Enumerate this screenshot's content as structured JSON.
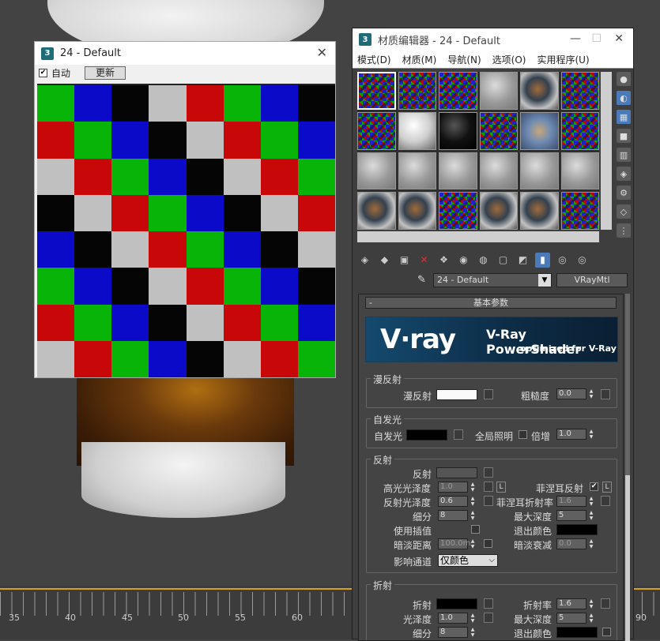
{
  "preview_window": {
    "title": "24 - Default",
    "auto_label": "自动",
    "auto_checked": true,
    "update_label": "更新"
  },
  "checker_grid": [
    [
      "green",
      "blue",
      "black",
      "gray",
      "red",
      "green",
      "blue",
      "black"
    ],
    [
      "red",
      "green",
      "blue",
      "black",
      "gray",
      "red",
      "green",
      "blue"
    ],
    [
      "gray",
      "red",
      "green",
      "blue",
      "black",
      "gray",
      "red",
      "green"
    ],
    [
      "black",
      "gray",
      "red",
      "green",
      "blue",
      "black",
      "gray",
      "red"
    ],
    [
      "blue",
      "black",
      "gray",
      "red",
      "green",
      "blue",
      "black",
      "gray"
    ],
    [
      "green",
      "blue",
      "black",
      "gray",
      "red",
      "green",
      "blue",
      "black"
    ],
    [
      "red",
      "green",
      "blue",
      "black",
      "gray",
      "red",
      "green",
      "blue"
    ],
    [
      "gray",
      "red",
      "green",
      "blue",
      "black",
      "gray",
      "red",
      "green"
    ]
  ],
  "colors": {
    "green": "#09b409",
    "blue": "#0a0ac8",
    "black": "#050505",
    "gray": "#c0c0c0",
    "red": "#c80808"
  },
  "material_editor": {
    "title": "材质编辑器 - 24 - Default",
    "menus": [
      "模式(D)",
      "材质(M)",
      "导航(N)",
      "选项(O)",
      "实用程序(U)"
    ],
    "slots": [
      "check",
      "check",
      "check",
      "gray",
      "glass",
      "check",
      "check",
      "white",
      "black",
      "check",
      "photo",
      "check",
      "gray",
      "gray",
      "gray",
      "gray",
      "gray",
      "gray",
      "glass",
      "glass",
      "check",
      "glass",
      "glass",
      "check"
    ],
    "selected_slot": 0,
    "material_name": "24 - Default",
    "material_type": "VRayMtl",
    "rollout_title": "基本参数",
    "banner_logo": "V·ray",
    "banner_title": "V-Ray PowerShader",
    "banner_subtitle": "optimized for V-Ray",
    "diffuse_group": {
      "title": "漫反射",
      "diffuse_label": "漫反射",
      "roughness_label": "粗糙度",
      "roughness_value": "0.0"
    },
    "self_illum_group": {
      "title": "自发光",
      "self_illum_label": "自发光",
      "gi_label": "全局照明",
      "multiplier_label": "倍增",
      "multiplier_value": "1.0"
    },
    "reflection_group": {
      "title": "反射",
      "reflect_label": "反射",
      "hilight_gloss_label": "高光光泽度",
      "hilight_gloss_value": "1.0",
      "hilight_lock": "L",
      "fresnel_label": "菲涅耳反射",
      "fresnel_checked": true,
      "fresnel_lock": "L",
      "refl_gloss_label": "反射光泽度",
      "refl_gloss_value": "0.6",
      "fresnel_ior_label": "菲涅耳折射率",
      "fresnel_ior_value": "1.6",
      "subdivs_label": "细分",
      "subdivs_value": "8",
      "max_depth_label": "最大深度",
      "max_depth_value": "5",
      "use_interp_label": "使用插值",
      "exit_color_label": "退出颜色",
      "dim_distance_label": "暗淡距离",
      "dim_distance_value": "100.0m",
      "dim_falloff_label": "暗淡衰减",
      "dim_falloff_value": "0.0",
      "affect_channels_label": "影响通道",
      "affect_channels_value": "仅颜色"
    },
    "refraction_group": {
      "title": "折射",
      "refract_label": "折射",
      "ior_label": "折射率",
      "ior_value": "1.6",
      "gloss_label": "光泽度",
      "gloss_value": "1.0",
      "max_depth_label": "最大深度",
      "max_depth_value": "5",
      "subdivs_label": "细分",
      "subdivs_value": "8",
      "exit_color_label": "退出颜色"
    }
  },
  "timeline": {
    "labels": [
      "35",
      "40",
      "45",
      "50",
      "55",
      "60",
      "90"
    ]
  }
}
